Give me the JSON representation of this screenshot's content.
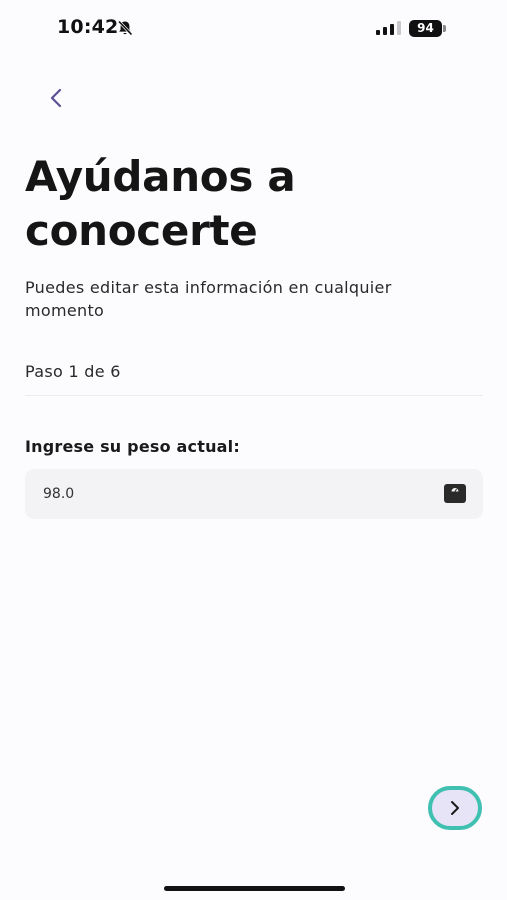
{
  "status_bar": {
    "time": "10:42",
    "battery": "94",
    "icons": [
      "bell-slash-icon",
      "signal-icon",
      "battery-icon"
    ]
  },
  "navigation": {
    "back_icon": "chevron-left-icon"
  },
  "header": {
    "title": "Ayúdanos a conocerte",
    "subtitle": "Puedes editar esta información en cualquier momento"
  },
  "progress": {
    "label": "Paso 1 de 6",
    "current_step": 1,
    "total_steps": 6
  },
  "form": {
    "weight": {
      "label": "Ingrese su peso actual:",
      "value": "98.0",
      "icon": "scale-icon"
    }
  },
  "footer": {
    "next_icon": "chevron-right-icon"
  },
  "colors": {
    "background": "#fcfbfe",
    "accent_purple": "#5a5290",
    "next_button_bg": "#e7e4f7",
    "next_button_ring": "#3fc0b0",
    "field_bg": "#f3f2f4"
  }
}
